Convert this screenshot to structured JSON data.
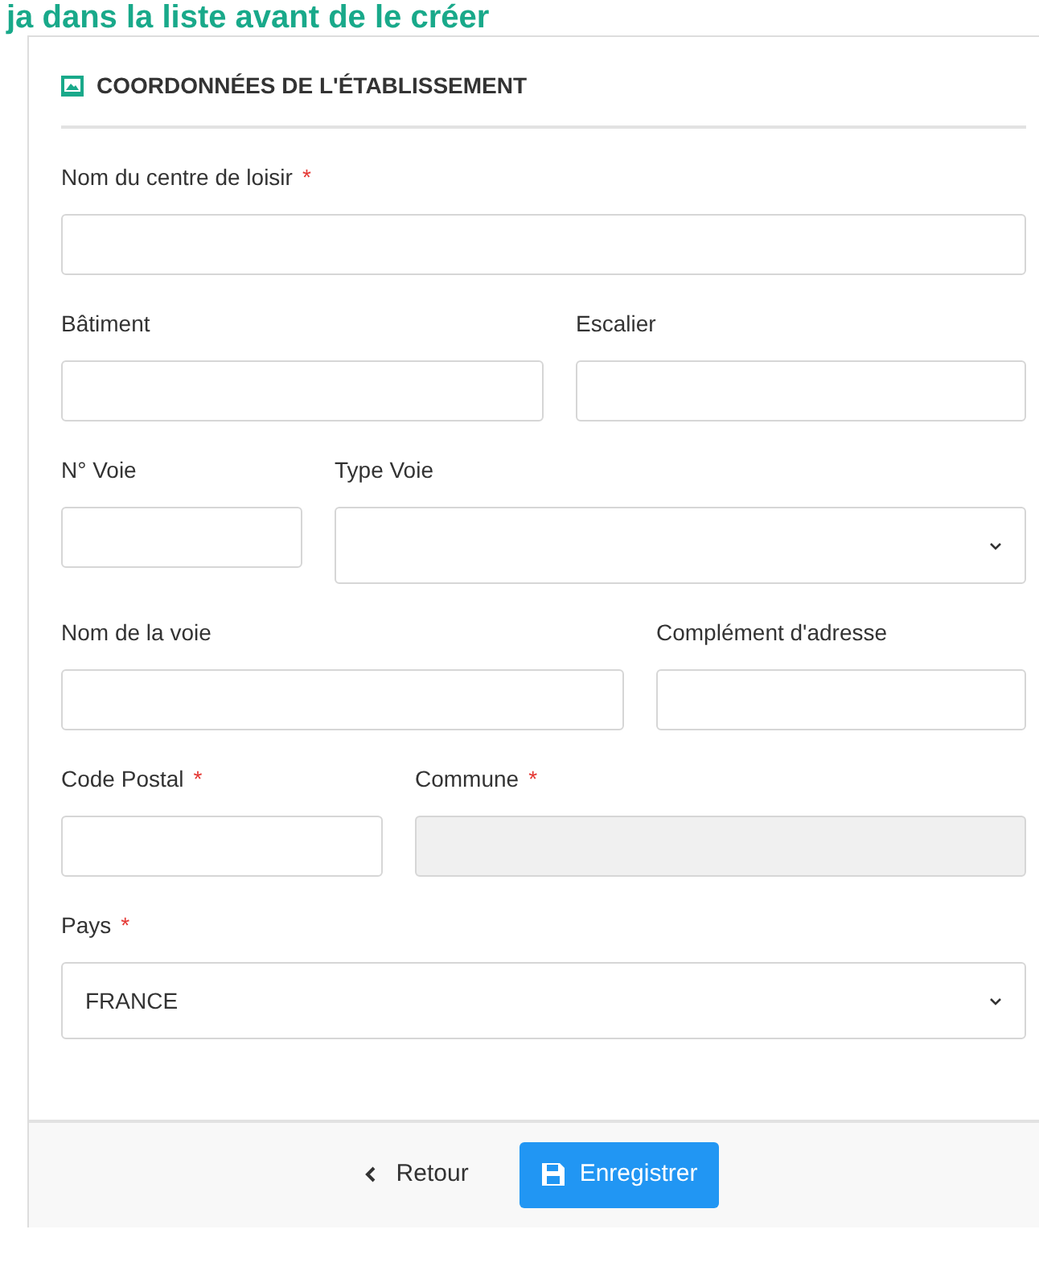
{
  "banner": "ja dans la liste avant de le créer",
  "section": {
    "title": "COORDONNÉES DE L'ÉTABLISSEMENT"
  },
  "rows": [
    {
      "fields": [
        {
          "label": "Nom du centre de loisir",
          "required_mark": "*",
          "kind": "text",
          "disabled": false
        }
      ]
    },
    {
      "fields": [
        {
          "label": "Bâtiment",
          "kind": "text",
          "disabled": false
        },
        {
          "label": "Escalier",
          "kind": "text",
          "disabled": false
        }
      ]
    },
    {
      "fields": [
        {
          "label": "N° Voie",
          "kind": "text",
          "disabled": false
        },
        {
          "label": "Type Voie",
          "kind": "select",
          "disabled": false
        }
      ]
    },
    {
      "fields": [
        {
          "label": "Nom de la voie",
          "kind": "text",
          "disabled": false
        },
        {
          "label": "Complément d'adresse",
          "kind": "text",
          "disabled": false
        }
      ]
    },
    {
      "fields": [
        {
          "label": "Code Postal",
          "required_mark": "*",
          "kind": "text",
          "disabled": false
        },
        {
          "label": "Commune",
          "required_mark": "*",
          "kind": "text",
          "disabled": true
        }
      ]
    },
    {
      "fields": [
        {
          "label": "Pays",
          "required_mark": "*",
          "kind": "select",
          "disabled": false,
          "value": "FRANCE"
        }
      ]
    }
  ],
  "footer": {
    "back": "Retour",
    "save": "Enregistrer"
  }
}
